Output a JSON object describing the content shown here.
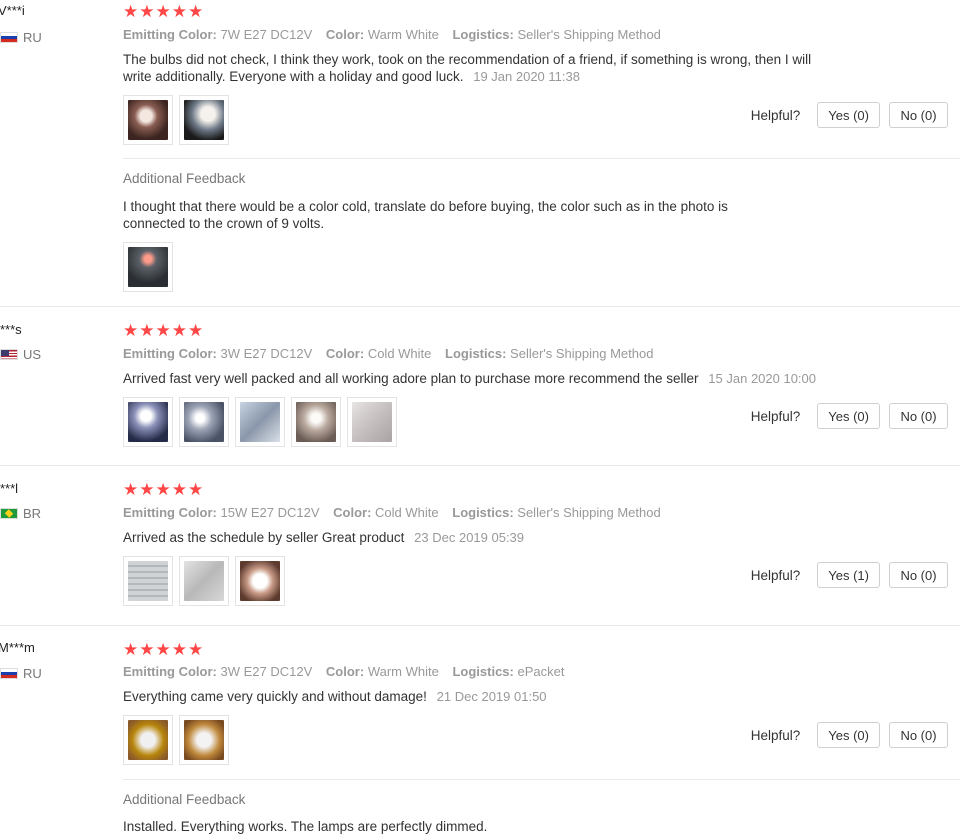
{
  "labels": {
    "emitting_color": "Emitting Color:",
    "color": "Color:",
    "logistics": "Logistics:",
    "helpful": "Helpful?",
    "additional_feedback": "Additional Feedback"
  },
  "star_color": "#ff4747",
  "reviews": [
    {
      "user": "V***i",
      "country": "RU",
      "rating": 5,
      "stars": "★★★★★",
      "emitting_color": "7W E27 DC12V",
      "color": "Warm White",
      "logistics": "Seller's Shipping Method",
      "text": "The bulbs did not check, I think they work, took on the recommendation of a friend, if something is wrong, then I will write additionally. Everyone with a holiday and good luck.",
      "date": "19 Jan 2020 11:38",
      "photo_count": 2,
      "yes": "Yes (0)",
      "no": "No (0)",
      "additional_feedback": {
        "text": "I thought that there would be a color cold, translate do before buying, the color such as in the photo is connected to the crown of 9 volts.",
        "photo_count": 1
      }
    },
    {
      "user": "***s",
      "country": "US",
      "rating": 5,
      "stars": "★★★★★",
      "emitting_color": "3W E27 DC12V",
      "color": "Cold White",
      "logistics": "Seller's Shipping Method",
      "text": "Arrived fast very well packed and all working adore plan to purchase more recommend the seller",
      "date": "15 Jan 2020 10:00",
      "photo_count": 5,
      "yes": "Yes (0)",
      "no": "No (0)"
    },
    {
      "user": "***l",
      "country": "BR",
      "rating": 5,
      "stars": "★★★★★",
      "emitting_color": "15W E27 DC12V",
      "color": "Cold White",
      "logistics": "Seller's Shipping Method",
      "text": "Arrived as the schedule by seller Great product",
      "date": "23 Dec 2019 05:39",
      "photo_count": 3,
      "yes": "Yes (1)",
      "no": "No (0)"
    },
    {
      "user": "M***m",
      "country": "RU",
      "rating": 5,
      "stars": "★★★★★",
      "emitting_color": "3W E27 DC12V",
      "color": "Warm White",
      "logistics": "ePacket",
      "text": "Everything came very quickly and without damage!",
      "date": "21 Dec 2019 01:50",
      "photo_count": 2,
      "yes": "Yes (0)",
      "no": "No (0)",
      "additional_feedback": {
        "text": "Installed. Everything works. The lamps are perfectly dimmed.",
        "photo_count": 0
      }
    }
  ]
}
